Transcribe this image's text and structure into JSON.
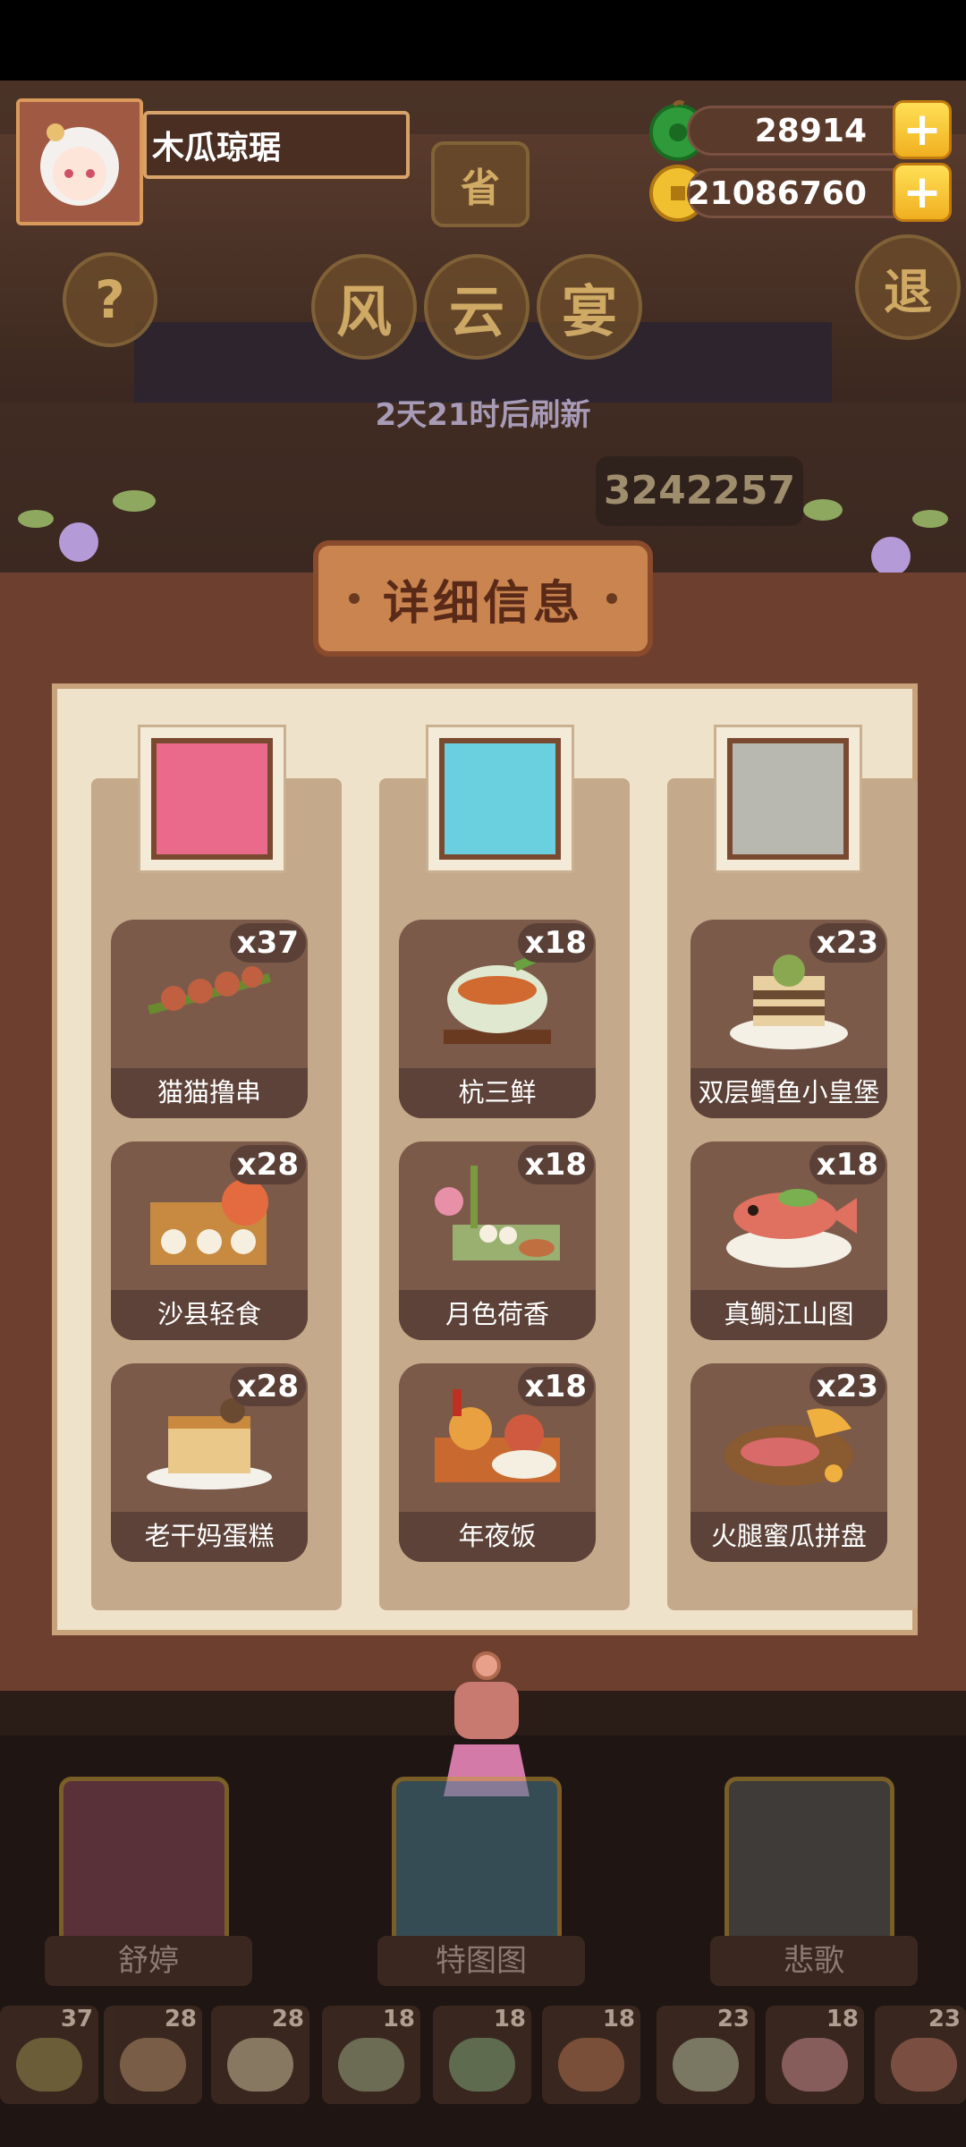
{
  "player": {
    "name": "木瓜琼琚"
  },
  "currency": {
    "jade": "28914",
    "coins": "21086760",
    "plus": "+"
  },
  "buttons": {
    "help": "?",
    "exit": "退",
    "region": "省"
  },
  "title": {
    "chars": [
      "风",
      "云",
      "宴"
    ]
  },
  "refresh_text": "2天21时后刷新",
  "score": "3242257",
  "panel": {
    "header": "详细信息",
    "columns": [
      {
        "dishes": [
          {
            "name": "猫猫撸串",
            "count": "x37"
          },
          {
            "name": "沙县轻食",
            "count": "x28"
          },
          {
            "name": "老干妈蛋糕",
            "count": "x28"
          }
        ]
      },
      {
        "dishes": [
          {
            "name": "杭三鲜",
            "count": "x18"
          },
          {
            "name": "月色荷香",
            "count": "x18"
          },
          {
            "name": "年夜饭",
            "count": "x18"
          }
        ]
      },
      {
        "dishes": [
          {
            "name": "双层鳕鱼小皇堡",
            "count": "x23"
          },
          {
            "name": "真鲷江山图",
            "count": "x18"
          },
          {
            "name": "火腿蜜瓜拼盘",
            "count": "x23"
          }
        ]
      }
    ]
  },
  "characters": [
    {
      "name": "舒婷"
    },
    {
      "name": "特图图"
    },
    {
      "name": "悲歌"
    }
  ],
  "dish_bar": [
    "37",
    "28",
    "28",
    "18",
    "18",
    "18",
    "23",
    "18",
    "23"
  ],
  "colors": {
    "panel_bg": "#efe2ca",
    "plaque": "#c9844f",
    "plus_yellow": "#ffd740"
  }
}
